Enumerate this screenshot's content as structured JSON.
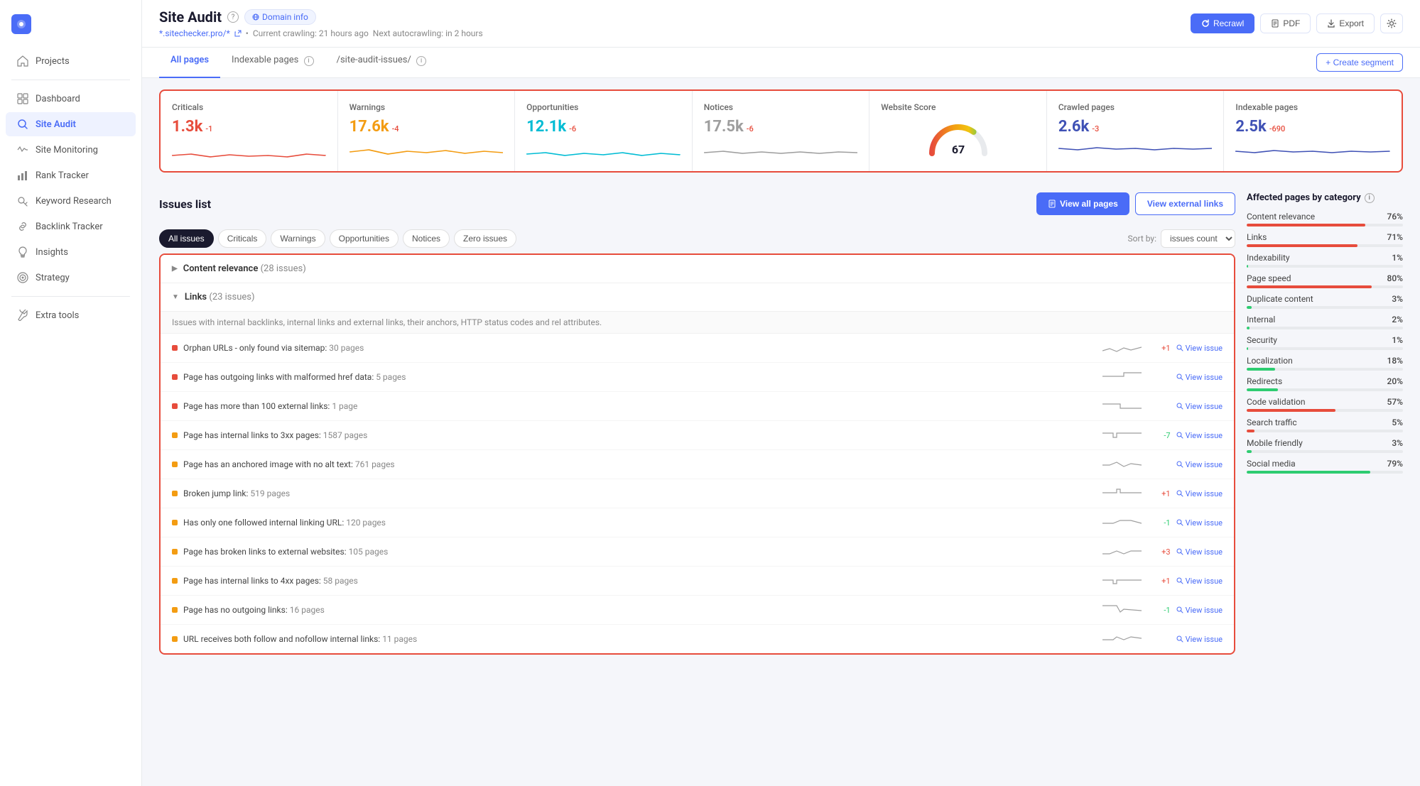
{
  "sidebar": {
    "logo": "Projects",
    "items": [
      {
        "id": "projects",
        "label": "Projects",
        "icon": "home"
      },
      {
        "id": "dashboard",
        "label": "Dashboard",
        "icon": "grid"
      },
      {
        "id": "site-audit",
        "label": "Site Audit",
        "icon": "search",
        "active": true
      },
      {
        "id": "site-monitoring",
        "label": "Site Monitoring",
        "icon": "activity"
      },
      {
        "id": "rank-tracker",
        "label": "Rank Tracker",
        "icon": "bar-chart"
      },
      {
        "id": "keyword-research",
        "label": "Keyword Research",
        "icon": "key"
      },
      {
        "id": "backlink-tracker",
        "label": "Backlink Tracker",
        "icon": "link"
      },
      {
        "id": "insights",
        "label": "Insights",
        "icon": "lightbulb"
      },
      {
        "id": "strategy",
        "label": "Strategy",
        "icon": "target"
      }
    ],
    "extra": [
      {
        "id": "extra-tools",
        "label": "Extra tools",
        "icon": "tool"
      }
    ]
  },
  "header": {
    "title": "Site Audit",
    "domain_info": "Domain info",
    "crawl_info": "*.sitechecker.pro/*",
    "crawl_status": "Current crawling: 21 hours ago",
    "next_crawl": "Next autocrawling: in 2 hours",
    "buttons": {
      "recrawl": "Recrawl",
      "pdf": "PDF",
      "export": "Export"
    }
  },
  "tabs": {
    "items": [
      "All pages",
      "Indexable pages",
      "/site-audit-issues/"
    ],
    "active": "All pages",
    "create_segment": "+ Create segment"
  },
  "stats": {
    "criticals": {
      "label": "Criticals",
      "value": "1.3k",
      "delta": "-1",
      "color": "#e74c3c"
    },
    "warnings": {
      "label": "Warnings",
      "value": "17.6k",
      "delta": "-4",
      "color": "#f39c12"
    },
    "opportunities": {
      "label": "Opportunities",
      "value": "12.1k",
      "delta": "-6",
      "color": "#00bcd4"
    },
    "notices": {
      "label": "Notices",
      "value": "17.5k",
      "delta": "-6",
      "color": "#9e9e9e"
    },
    "website_score": {
      "label": "Website Score",
      "value": "67"
    },
    "crawled_pages": {
      "label": "Crawled pages",
      "value": "2.6k",
      "delta": "-3",
      "color": "#3f51b5"
    },
    "indexable_pages": {
      "label": "Indexable pages",
      "value": "2.5k",
      "delta": "-690",
      "color": "#3f51b5"
    }
  },
  "issues": {
    "title": "Issues list",
    "view_all_pages": "View all pages",
    "view_external": "View external links",
    "filters": [
      "All issues",
      "Criticals",
      "Warnings",
      "Opportunities",
      "Notices",
      "Zero issues"
    ],
    "active_filter": "All issues",
    "sort_label": "Sort by:",
    "sort_value": "issues count",
    "categories": [
      {
        "name": "Content relevance",
        "count": "28 issues",
        "expanded": false
      },
      {
        "name": "Links",
        "count": "23 issues",
        "expanded": true,
        "description": "Issues with internal backlinks, internal links and external links, their anchors, HTTP status codes and rel attributes.",
        "items": [
          {
            "severity": "critical",
            "text": "Orphan URLs - only found via sitemap:",
            "pages": "30 pages",
            "delta": "+1",
            "delta_type": "pos"
          },
          {
            "severity": "critical",
            "text": "Page has outgoing links with malformed href data:",
            "pages": "5 pages",
            "delta": "",
            "delta_type": "none"
          },
          {
            "severity": "critical",
            "text": "Page has more than 100 external links:",
            "pages": "1 page",
            "delta": "",
            "delta_type": "none"
          },
          {
            "severity": "warning",
            "text": "Page has internal links to 3xx pages:",
            "pages": "1587 pages",
            "delta": "-7",
            "delta_type": "neg"
          },
          {
            "severity": "warning",
            "text": "Page has an anchored image with no alt text:",
            "pages": "761 pages",
            "delta": "",
            "delta_type": "none"
          },
          {
            "severity": "warning",
            "text": "Broken jump link:",
            "pages": "519 pages",
            "delta": "+1",
            "delta_type": "pos"
          },
          {
            "severity": "warning",
            "text": "Has only one followed internal linking URL:",
            "pages": "120 pages",
            "delta": "-1",
            "delta_type": "neg"
          },
          {
            "severity": "warning",
            "text": "Page has broken links to external websites:",
            "pages": "105 pages",
            "delta": "+3",
            "delta_type": "pos"
          },
          {
            "severity": "warning",
            "text": "Page has internal links to 4xx pages:",
            "pages": "58 pages",
            "delta": "+1",
            "delta_type": "pos"
          },
          {
            "severity": "warning",
            "text": "Page has no outgoing links:",
            "pages": "16 pages",
            "delta": "-1",
            "delta_type": "neg"
          },
          {
            "severity": "warning",
            "text": "URL receives both follow and nofollow internal links:",
            "pages": "11 pages",
            "delta": "",
            "delta_type": "none"
          }
        ]
      }
    ]
  },
  "affected_pages": {
    "title": "Affected pages by category",
    "items": [
      {
        "label": "Content relevance",
        "pct": 76,
        "bar_color": "fill-red"
      },
      {
        "label": "Links",
        "pct": 71,
        "bar_color": "fill-red"
      },
      {
        "label": "Indexability",
        "pct": 1,
        "bar_color": "fill-green"
      },
      {
        "label": "Page speed",
        "pct": 80,
        "bar_color": "fill-red"
      },
      {
        "label": "Duplicate content",
        "pct": 3,
        "bar_color": "fill-green"
      },
      {
        "label": "Internal",
        "pct": 2,
        "bar_color": "fill-green"
      },
      {
        "label": "Security",
        "pct": 1,
        "bar_color": "fill-green"
      },
      {
        "label": "Localization",
        "pct": 18,
        "bar_color": "fill-green"
      },
      {
        "label": "Redirects",
        "pct": 20,
        "bar_color": "fill-green"
      },
      {
        "label": "Code validation",
        "pct": 57,
        "bar_color": "fill-red"
      },
      {
        "label": "Search traffic",
        "pct": 5,
        "bar_color": "fill-red"
      },
      {
        "label": "Mobile friendly",
        "pct": 3,
        "bar_color": "fill-green"
      },
      {
        "label": "Social media",
        "pct": 79,
        "bar_color": "fill-green"
      }
    ]
  }
}
